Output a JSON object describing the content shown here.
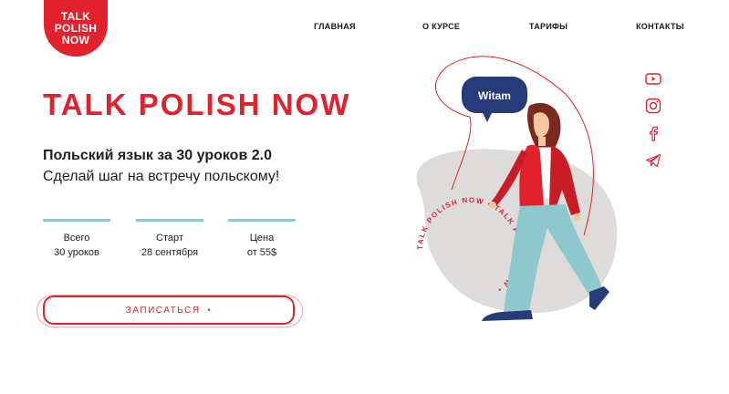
{
  "logo": {
    "line1": "TALK",
    "line2": "POLISH",
    "line3": "NOW"
  },
  "nav": [
    {
      "label": "ГЛАВНАЯ"
    },
    {
      "label": "О КУРСЕ"
    },
    {
      "label": "ТАРИФЫ"
    },
    {
      "label": "КОНТАКТЫ"
    }
  ],
  "hero": {
    "title": "TALK POLISH NOW",
    "subtitle": "Польский язык за 30 уроков 2.0",
    "tagline": "Сделай шаг на встречу польскому!"
  },
  "stats": [
    {
      "label": "Всего",
      "value": "30 уроков"
    },
    {
      "label": "Старт",
      "value": "28 сентября"
    },
    {
      "label": "Цена",
      "value": "от 55$"
    }
  ],
  "cta": {
    "label": "ЗАПИСАТЬСЯ",
    "dot": "•"
  },
  "illustration": {
    "speech_bubble": "Witam",
    "circle_text": "TALK POLISH NOW • TALK POLISH NOW •"
  },
  "social": [
    {
      "icon": "youtube-icon"
    },
    {
      "icon": "instagram-icon"
    },
    {
      "icon": "facebook-icon"
    },
    {
      "icon": "telegram-icon"
    }
  ],
  "colors": {
    "brand_red": "#e1222d",
    "accent_teal": "#8ec7cc",
    "blob_gray": "#dedbdb",
    "bubble_navy": "#273a7a"
  }
}
